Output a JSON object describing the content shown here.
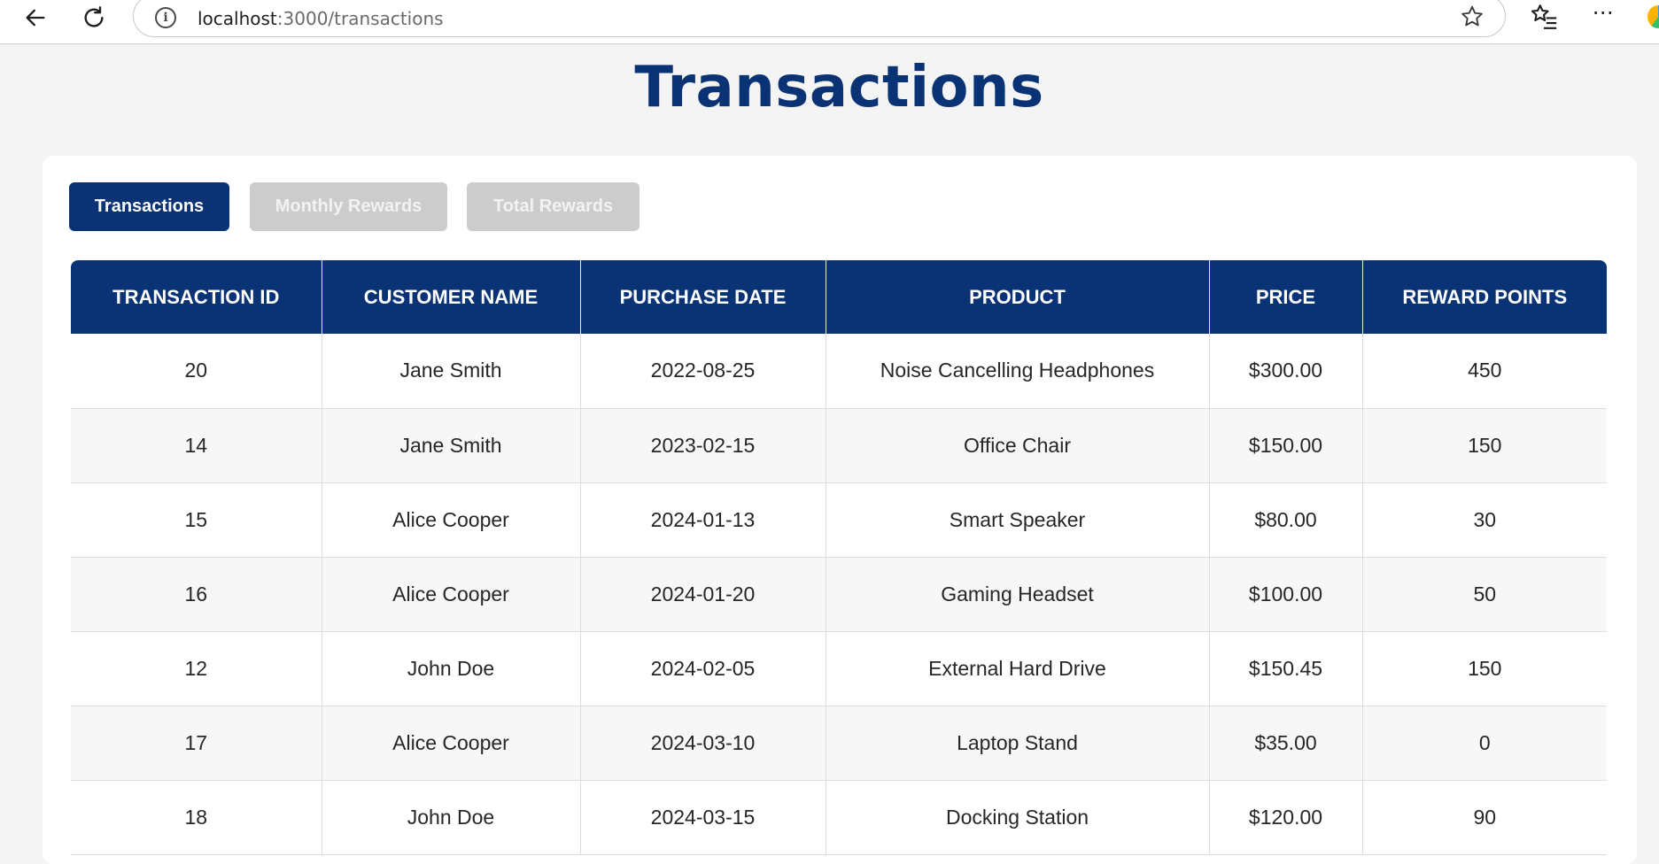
{
  "browser": {
    "url_host": "localhost",
    "url_path": ":3000/transactions",
    "info_glyph": "i",
    "more_glyph": "⋯"
  },
  "page": {
    "title": "Transactions"
  },
  "tabs": [
    {
      "label": "Transactions",
      "active": true
    },
    {
      "label": "Monthly Rewards",
      "active": false
    },
    {
      "label": "Total Rewards",
      "active": false
    }
  ],
  "table": {
    "headers": [
      "TRANSACTION ID",
      "CUSTOMER NAME",
      "PURCHASE DATE",
      "PRODUCT",
      "PRICE",
      "REWARD POINTS"
    ],
    "rows": [
      [
        "20",
        "Jane Smith",
        "2022-08-25",
        "Noise Cancelling Headphones",
        "$300.00",
        "450"
      ],
      [
        "14",
        "Jane Smith",
        "2023-02-15",
        "Office Chair",
        "$150.00",
        "150"
      ],
      [
        "15",
        "Alice Cooper",
        "2024-01-13",
        "Smart Speaker",
        "$80.00",
        "30"
      ],
      [
        "16",
        "Alice Cooper",
        "2024-01-20",
        "Gaming Headset",
        "$100.00",
        "50"
      ],
      [
        "12",
        "John Doe",
        "2024-02-05",
        "External Hard Drive",
        "$150.45",
        "150"
      ],
      [
        "17",
        "Alice Cooper",
        "2024-03-10",
        "Laptop Stand",
        "$35.00",
        "0"
      ],
      [
        "18",
        "John Doe",
        "2024-03-15",
        "Docking Station",
        "$120.00",
        "90"
      ]
    ]
  },
  "colors": {
    "primary": "#0a3375",
    "inactive_tab": "#cccccc",
    "page_bg": "#f4f4f4"
  }
}
